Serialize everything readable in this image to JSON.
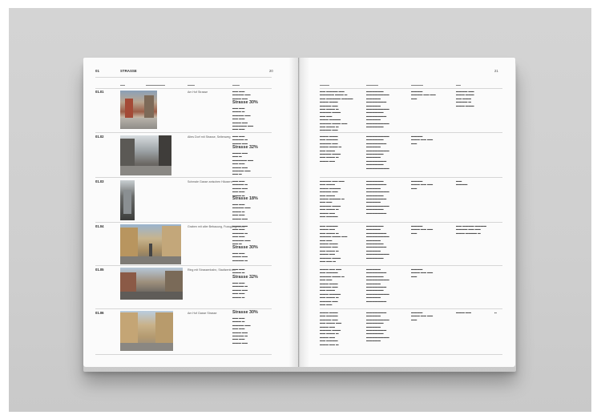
{
  "header": {
    "chapter": "01",
    "title": "STRASSE",
    "page_left": "20",
    "page_right": "21"
  },
  "rows": [
    {
      "id": "01.01",
      "caption": "Am Hof Strasse",
      "highlight": "Strasse 30%"
    },
    {
      "id": "01.02",
      "caption": "Altes Dorf mit Strasse, Seitenweg",
      "highlight": "Strasse 32%"
    },
    {
      "id": "01.03",
      "caption": "Schmale Gasse zwischen Häusern",
      "highlight": "Strasse 18%"
    },
    {
      "id": "01.04",
      "caption": "Graben mit alter Bebauung, Fussgängerzone",
      "highlight": "Strasse 30%"
    },
    {
      "id": "01.05",
      "caption": "Ring mit Strassenbahn, Stadtzentrum",
      "highlight": "Strasse 32%"
    },
    {
      "id": "01.06",
      "caption": "Am Hof Gasse Strasse",
      "highlight": "Strasse 30%"
    }
  ],
  "colors": {
    "background": "#d0d0d0",
    "paper": "#fbfbfb",
    "rule": "#d6d6d6"
  }
}
